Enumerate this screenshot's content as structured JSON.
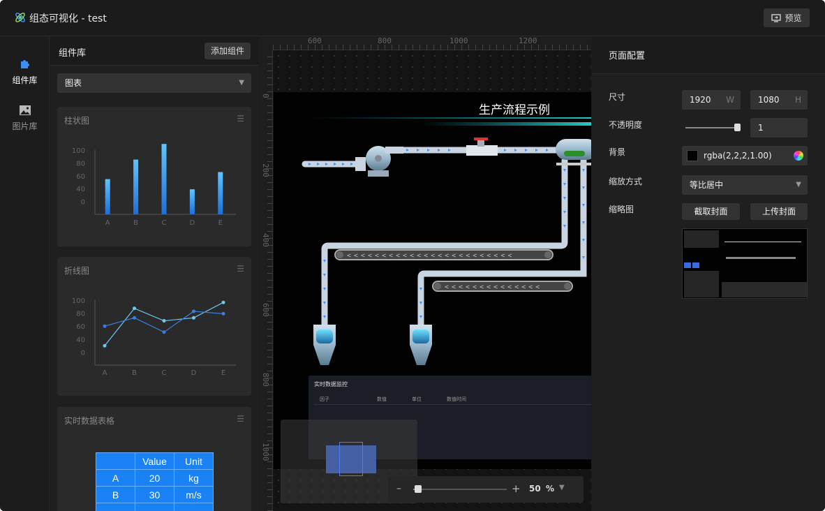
{
  "header": {
    "title": "组态可视化 - test",
    "preview_label": "预览"
  },
  "nav": {
    "items": [
      {
        "label": "组件库",
        "icon": "puzzle-icon"
      },
      {
        "label": "图片库",
        "icon": "image-icon"
      }
    ]
  },
  "library": {
    "title": "组件库",
    "add_label": "添加组件",
    "category": "图表",
    "bar_card": {
      "title": "柱状图"
    },
    "line_card": {
      "title": "折线图"
    },
    "table_card": {
      "title": "实时数据表格",
      "headers": [
        "",
        "Value",
        "Unit"
      ],
      "rows": [
        [
          "A",
          "20",
          "kg"
        ],
        [
          "B",
          "30",
          "m/s"
        ]
      ]
    }
  },
  "chart_data": [
    {
      "type": "bar",
      "categories": [
        "A",
        "B",
        "C",
        "D",
        "E"
      ],
      "values": [
        45,
        70,
        90,
        32,
        54
      ],
      "ylim": [
        0,
        100
      ],
      "yticks": [
        "100",
        "80",
        "60",
        "40",
        "0"
      ],
      "color": "#3a9cf0"
    },
    {
      "type": "line",
      "categories": [
        "A",
        "B",
        "C",
        "D",
        "E"
      ],
      "series": [
        {
          "values": [
            15,
            78,
            57,
            62,
            88
          ],
          "color": "#6cc8f0"
        },
        {
          "values": [
            48,
            62,
            38,
            73,
            69
          ],
          "color": "#3a7fe0"
        }
      ],
      "ylim": [
        0,
        100
      ],
      "yticks": [
        "100",
        "80",
        "60",
        "40",
        "0"
      ]
    }
  ],
  "canvas": {
    "ruler_h": [
      "600",
      "800",
      "1000",
      "1200"
    ],
    "ruler_v": [
      "0",
      "200",
      "400",
      "600",
      "800",
      "1000"
    ],
    "page_title": "生产流程示例",
    "monitor": {
      "title": "实时数据监控",
      "columns": [
        "因子",
        "数值",
        "单位",
        "数值时间"
      ]
    },
    "zoom": {
      "minus": "–",
      "plus": "+",
      "value": "50",
      "unit": "%",
      "percent": 0.05
    }
  },
  "panel": {
    "title": "页面配置",
    "size_label": "尺寸",
    "width": "1920",
    "width_suffix": "W",
    "height": "1080",
    "height_suffix": "H",
    "opacity_label": "不透明度",
    "opacity_value": "1",
    "bg_label": "背景",
    "bg_value": "rgba(2,2,2,1.00)",
    "scale_label": "缩放方式",
    "scale_value": "等比居中",
    "thumb_label": "缩略图",
    "capture_label": "截取封面",
    "upload_label": "上传封面"
  }
}
